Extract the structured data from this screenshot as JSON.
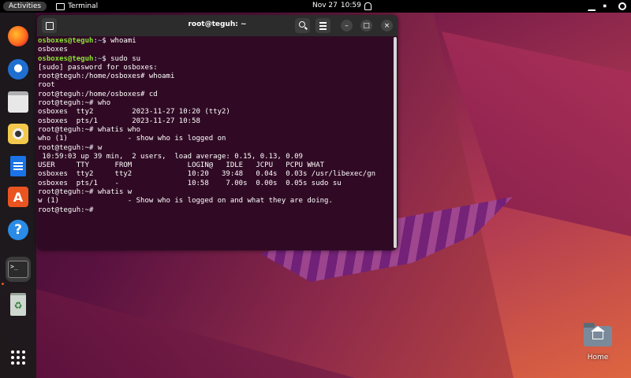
{
  "topbar": {
    "activities": "Activities",
    "app_name": "Terminal",
    "date": "Nov 27",
    "time": "10:59"
  },
  "dock": {
    "items": [
      "firefox-icon",
      "thunderbird-icon",
      "files-icon",
      "rhythmbox-icon",
      "libreoffice-writer-icon",
      "software-store-icon",
      "help-icon",
      "terminal-icon",
      "trash-icon",
      "show-apps-icon"
    ]
  },
  "terminal": {
    "title": "root@teguh: ~",
    "lines": [
      {
        "user": "osboxes@teguh",
        "path": "~",
        "sym": "$ ",
        "cmd": "whoami"
      },
      {
        "text": "osboxes"
      },
      {
        "user": "osboxes@teguh",
        "path": "~",
        "sym": "$ ",
        "cmd": "sudo su"
      },
      {
        "text": "[sudo] password for osboxes:"
      },
      {
        "text": "root@teguh:/home/osboxes# whoami"
      },
      {
        "text": "root"
      },
      {
        "text": "root@teguh:/home/osboxes# cd"
      },
      {
        "text": "root@teguh:~# who"
      },
      {
        "text": "osboxes  tty2         2023-11-27 10:20 (tty2)"
      },
      {
        "text": "osboxes  pts/1        2023-11-27 10:58"
      },
      {
        "text": "root@teguh:~# whatis who"
      },
      {
        "text": "who (1)              - show who is logged on"
      },
      {
        "text": "root@teguh:~# w"
      },
      {
        "text": " 10:59:03 up 39 min,  2 users,  load average: 0.15, 0.13, 0.09"
      },
      {
        "text": "USER     TTY      FROM             LOGIN@   IDLE   JCPU   PCPU WHAT"
      },
      {
        "text": "osboxes  tty2     tty2             10:20   39:48   0.04s  0.03s /usr/libexec/gn"
      },
      {
        "text": "osboxes  pts/1    -                10:58    7.00s  0.00s  0.05s sudo su"
      },
      {
        "text": "root@teguh:~# whatis w"
      },
      {
        "text": "w (1)                - Show who is logged on and what they are doing."
      },
      {
        "text": "root@teguh:~# "
      }
    ]
  },
  "desktop": {
    "home_label": "Home"
  }
}
